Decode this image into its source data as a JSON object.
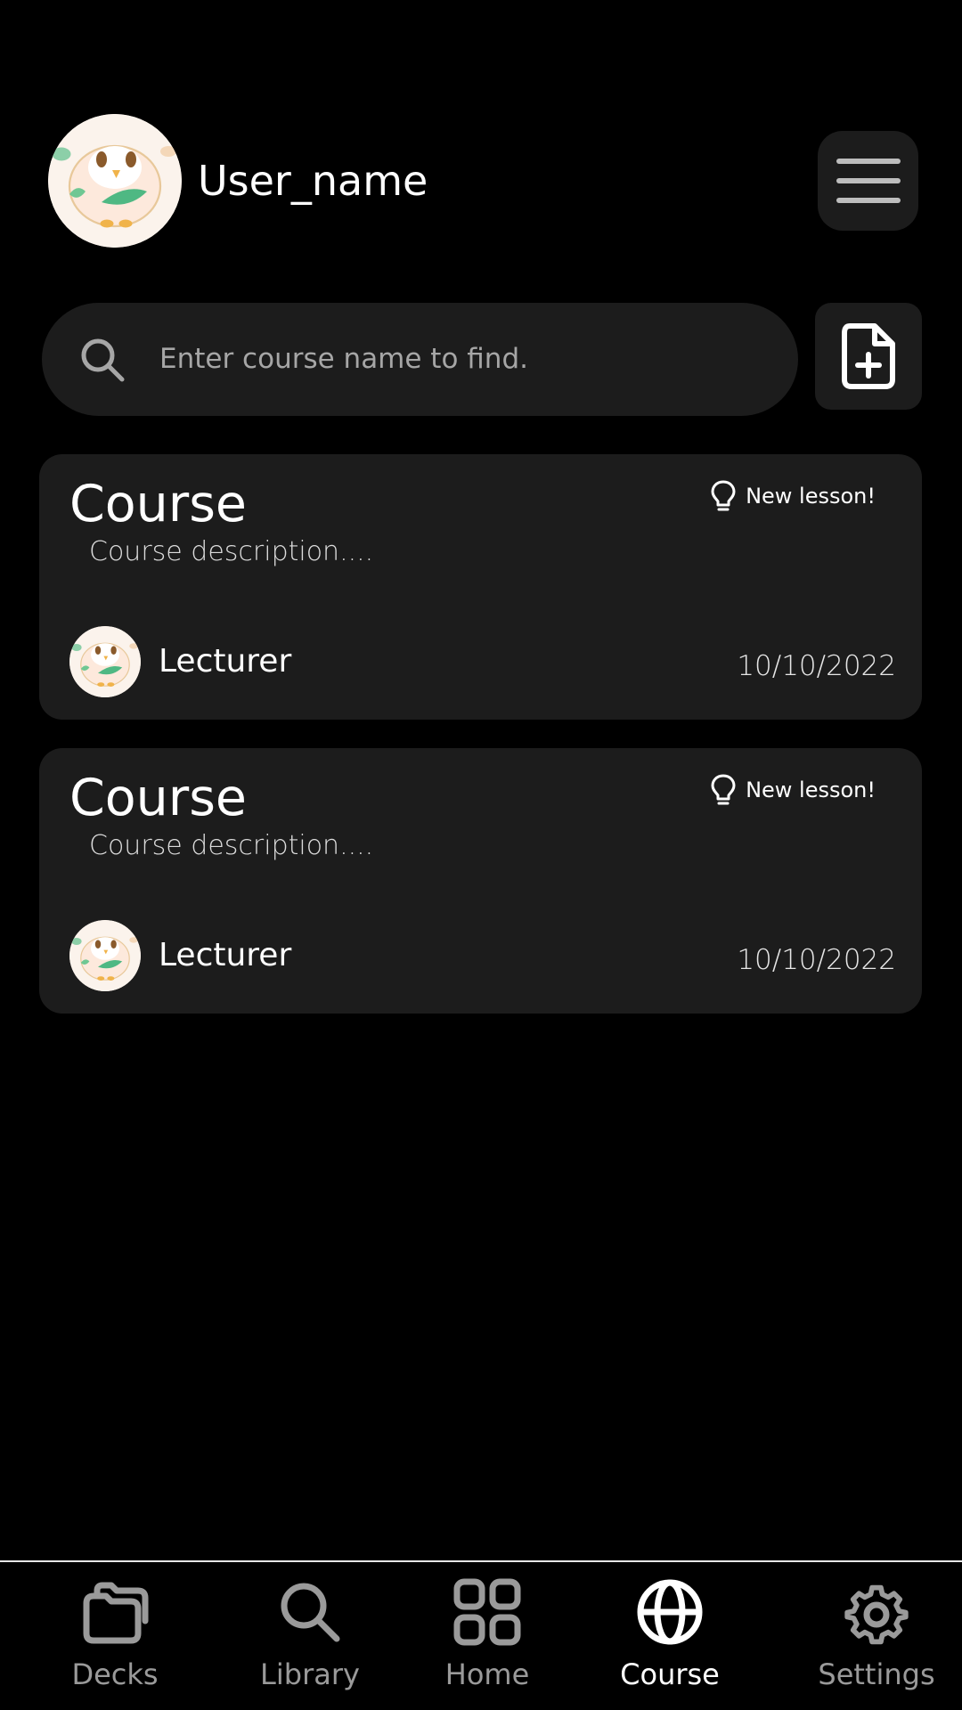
{
  "header": {
    "username": "User_name",
    "avatar_icon": "bird-avatar-icon",
    "menu_icon": "hamburger-menu-icon"
  },
  "search": {
    "placeholder": "Enter course name to find.",
    "value": "",
    "icon": "search-icon",
    "add_icon": "file-plus-icon"
  },
  "courses": [
    {
      "title": "Course",
      "badge": "New lesson!",
      "badge_icon": "lightbulb-icon",
      "description": "Course description....",
      "lecturer": "Lecturer",
      "date": "10/10/2022"
    },
    {
      "title": "Course",
      "badge": "New lesson!",
      "badge_icon": "lightbulb-icon",
      "description": "Course description....",
      "lecturer": "Lecturer",
      "date": "10/10/2022"
    }
  ],
  "nav": {
    "active": "Course",
    "items": [
      {
        "label": "Decks",
        "icon": "folder-icon"
      },
      {
        "label": "Library",
        "icon": "search-icon"
      },
      {
        "label": "Home",
        "icon": "grid-icon"
      },
      {
        "label": "Course",
        "icon": "globe-icon"
      },
      {
        "label": "Settings",
        "icon": "gear-icon"
      }
    ]
  },
  "colors": {
    "background": "#000000",
    "surface": "#1c1c1c",
    "text_primary": "#ffffff",
    "text_muted": "#9a9a9a"
  }
}
